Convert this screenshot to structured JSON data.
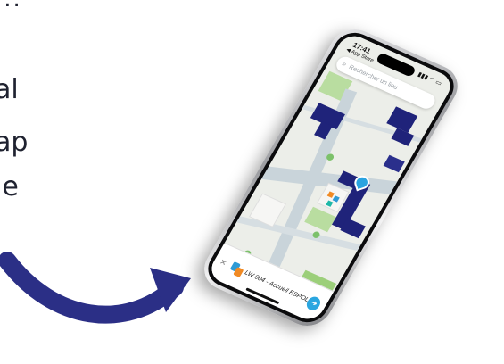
{
  "left_text": {
    "dots": "...",
    "line1": "al",
    "line2": "ap",
    "line3": "le"
  },
  "phone": {
    "status_time": "17:41",
    "status_back": "◀ App Store",
    "status_icons": "▮▮▮ ◠ ▭",
    "search_placeholder": "Rechercher un lieu",
    "poi_label": "LW 004 - Accueil ESPOL"
  },
  "colors": {
    "arrow": "#2b2f86",
    "building": "#1f237a",
    "road": "#c9d4da",
    "park": "#9ccf7a",
    "accent": "#29a3e0"
  }
}
